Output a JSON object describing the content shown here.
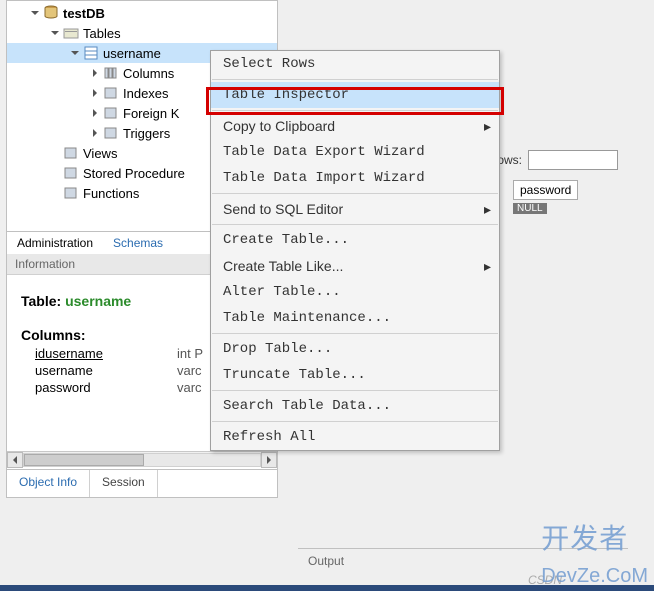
{
  "tree": {
    "db": "testDB",
    "tables_label": "Tables",
    "table": "username",
    "columns_label": "Columns",
    "indexes_label": "Indexes",
    "foreign_label": "Foreign K",
    "triggers_label": "Triggers",
    "views_label": "Views",
    "procedures_label": "Stored Procedure",
    "functions_label": "Functions"
  },
  "tabs": {
    "administration": "Administration",
    "schemas": "Schemas"
  },
  "info": {
    "header": "Information",
    "table_prefix": "Table: ",
    "table_name": "username",
    "columns_title": "Columns:",
    "cols": [
      {
        "name": "idusername",
        "type": "int P",
        "pk": true
      },
      {
        "name": "username",
        "type": "varc",
        "pk": false
      },
      {
        "name": "password",
        "type": "varc",
        "pk": false
      }
    ]
  },
  "bottom_tabs": {
    "object_info": "Object Info",
    "session": "Session"
  },
  "context_menu": {
    "select_rows": "Select Rows",
    "table_inspector": "Table Inspector",
    "copy_clipboard": "Copy to Clipboard",
    "export_wizard": "Table Data Export Wizard",
    "import_wizard": "Table Data Import Wizard",
    "send_sql": "Send to SQL Editor",
    "create_table": "Create Table...",
    "create_table_like": "Create Table Like...",
    "alter_table": "Alter Table...",
    "maintenance": "Table Maintenance...",
    "drop_table": "Drop Table...",
    "truncate": "Truncate Table...",
    "search": "Search Table Data...",
    "refresh": "Refresh All"
  },
  "right": {
    "rows_label": "ows:",
    "password_label": "password",
    "null": "NULL"
  },
  "output": {
    "label": "Output"
  },
  "watermark": {
    "brand": "开发者",
    "domain": "DevZe.CoM",
    "csdn": "CSDN"
  }
}
